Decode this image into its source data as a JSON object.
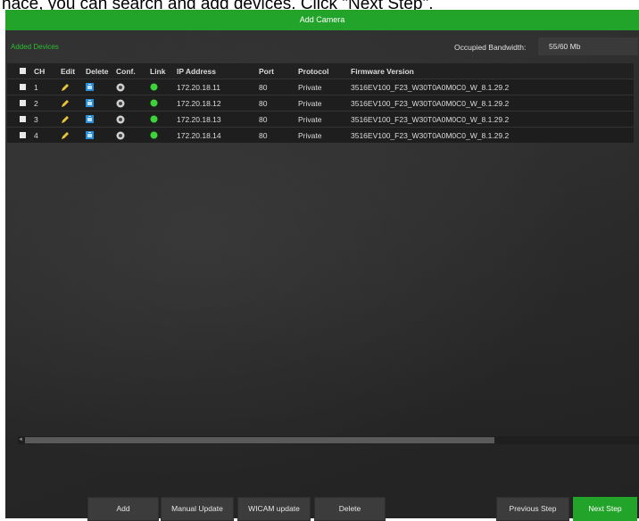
{
  "caption": "nace, you can search and add devices. Click \"Next Step\".",
  "window": {
    "title": "Add Camera"
  },
  "subheader": {
    "added_devices_label": "Added Devices",
    "bandwidth_label": "Occupied Bandwidth:",
    "bandwidth_value": "55/60 Mb"
  },
  "table": {
    "headers": {
      "ch": "CH",
      "edit": "Edit",
      "delete": "Delete",
      "conf": "Conf.",
      "link": "Link",
      "ip": "IP Address",
      "port": "Port",
      "protocol": "Protocol",
      "firmware": "Firmware Version"
    },
    "rows": [
      {
        "ch": "1",
        "ip": "172.20.18.11",
        "port": "80",
        "protocol": "Private",
        "firmware": "3516EV100_F23_W30T0A0M0C0_W_8.1.29.2"
      },
      {
        "ch": "2",
        "ip": "172.20.18.12",
        "port": "80",
        "protocol": "Private",
        "firmware": "3516EV100_F23_W30T0A0M0C0_W_8.1.29.2"
      },
      {
        "ch": "3",
        "ip": "172.20.18.13",
        "port": "80",
        "protocol": "Private",
        "firmware": "3516EV100_F23_W30T0A0M0C0_W_8.1.29.2"
      },
      {
        "ch": "4",
        "ip": "172.20.18.14",
        "port": "80",
        "protocol": "Private",
        "firmware": "3516EV100_F23_W30T0A0M0C0_W_8.1.29.2"
      }
    ]
  },
  "buttons": {
    "add": "Add",
    "manual_update": "Manual Update",
    "wicam_update": "WICAM update",
    "delete": "Delete",
    "previous_step": "Previous Step",
    "next_step": "Next Step"
  },
  "colors": {
    "accent": "#22a329",
    "link_online": "#3dd13a",
    "pencil": "#e8c43a",
    "delete_icon": "#2a8fd8"
  }
}
